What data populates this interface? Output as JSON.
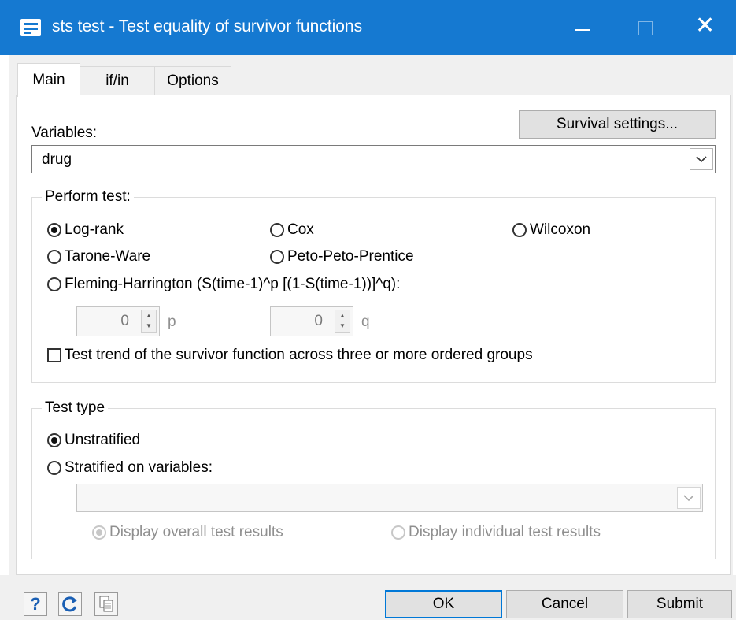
{
  "window": {
    "title": "sts test - Test equality of survivor functions",
    "controls": {
      "minimize": "—",
      "maximize": "□",
      "close": "✕"
    }
  },
  "tabs": [
    {
      "label": "Main",
      "active": true
    },
    {
      "label": "if/in",
      "active": false
    },
    {
      "label": "Options",
      "active": false
    }
  ],
  "main": {
    "variables_label": "Variables:",
    "survival_settings_label": "Survival settings...",
    "variables_value": "drug",
    "perform_test": {
      "legend": "Perform test:",
      "options": [
        "Log-rank",
        "Cox",
        "Wilcoxon",
        "Tarone-Ware",
        "Peto-Peto-Prentice",
        "Fleming-Harrington (S(time-1)^p [(1-S(time-1))]^q):"
      ],
      "selected": "Log-rank",
      "p_value": "0",
      "p_label": "p",
      "q_value": "0",
      "q_label": "q",
      "trend_label": "Test trend of the survivor function across three or more ordered groups",
      "trend_checked": false
    },
    "test_type": {
      "legend": "Test type",
      "unstratified_label": "Unstratified",
      "stratified_label": "Stratified on variables:",
      "selected": "Unstratified",
      "strata_value": "",
      "display_overall_label": "Display overall test results",
      "display_individual_label": "Display individual test results"
    }
  },
  "footer": {
    "help_icon": "question-icon",
    "reset_icon": "reset-icon",
    "copy_icon": "copy-icon",
    "help_glyph": "?",
    "ok_label": "OK",
    "cancel_label": "Cancel",
    "submit_label": "Submit"
  },
  "colors": {
    "titlebar": "#1579d1",
    "accent": "#0078d7"
  }
}
